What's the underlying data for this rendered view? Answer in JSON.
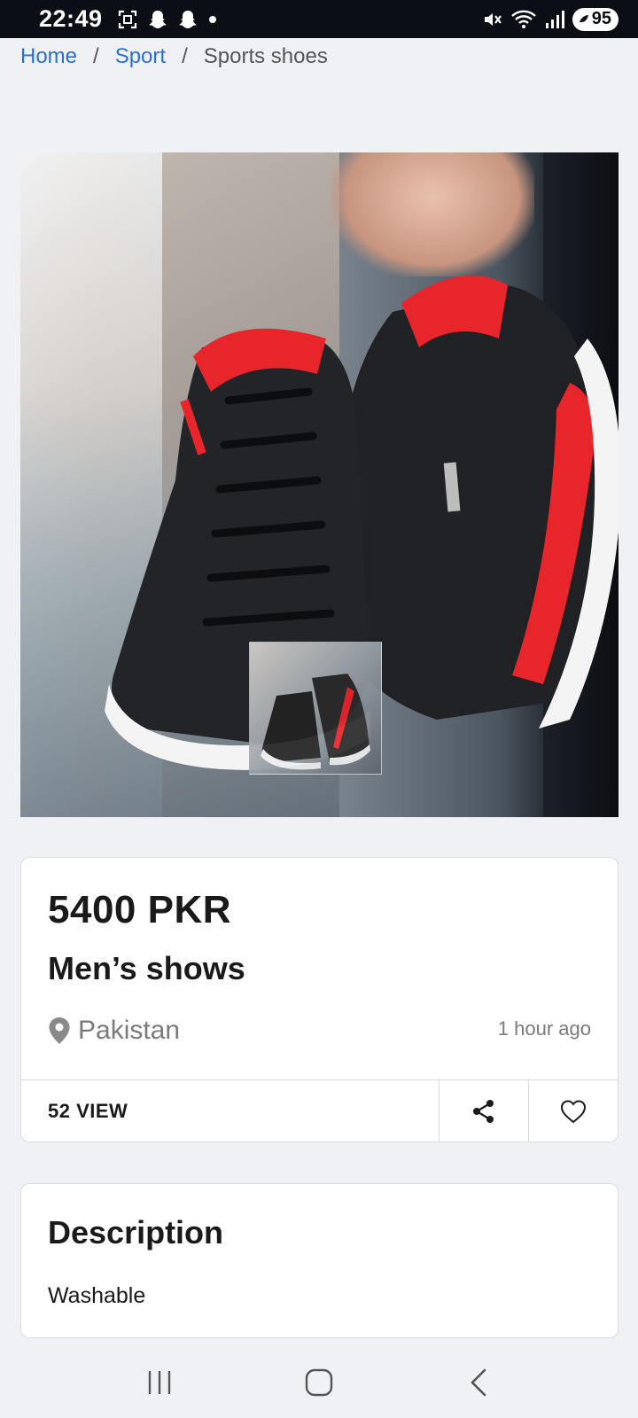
{
  "status_bar": {
    "time": "22:49",
    "battery": "95"
  },
  "breadcrumb": {
    "items": [
      "Home",
      "Sport",
      "Sports shoes"
    ],
    "separator": "/"
  },
  "product": {
    "price": "5400 PKR",
    "title": "Men’s shows",
    "location": "Pakistan",
    "posted": "1 hour ago",
    "views": "52 VIEW"
  },
  "description": {
    "heading": "Description",
    "text": "Washable"
  },
  "colors": {
    "link": "#2b6fd1",
    "background": "#f0f1f5",
    "shoe_accent": "#e8252b"
  }
}
